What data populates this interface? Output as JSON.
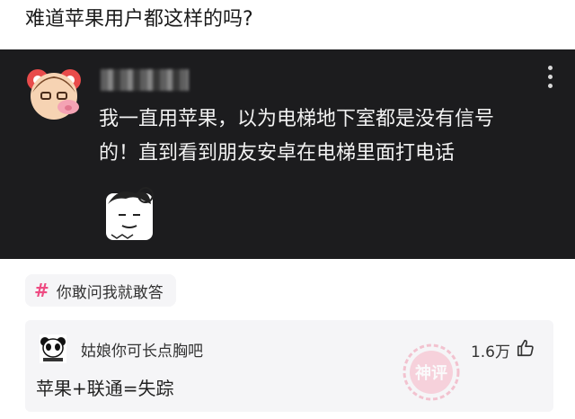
{
  "question": {
    "title": "难道苹果用户都这样的吗?"
  },
  "post": {
    "line1": "我一直用苹果，以为电梯地下室都是没有信号",
    "line2": "的！直到看到朋友安卓在电梯里面打电话",
    "icons": {
      "more": "more-vertical-icon",
      "sticker": "cartoon-sticker"
    }
  },
  "topic": {
    "hash": "#",
    "label": "你敢问我就敢答"
  },
  "comment": {
    "username": "姑娘你可长点胸吧",
    "likes": "1.6万",
    "text": "苹果+联通=失踪",
    "stamp": "神评",
    "icons": {
      "like": "thumbs-up-icon",
      "avatar": "panda-avatar"
    }
  },
  "colors": {
    "accent": "#ee4b82",
    "card": "#1c1c1e"
  }
}
